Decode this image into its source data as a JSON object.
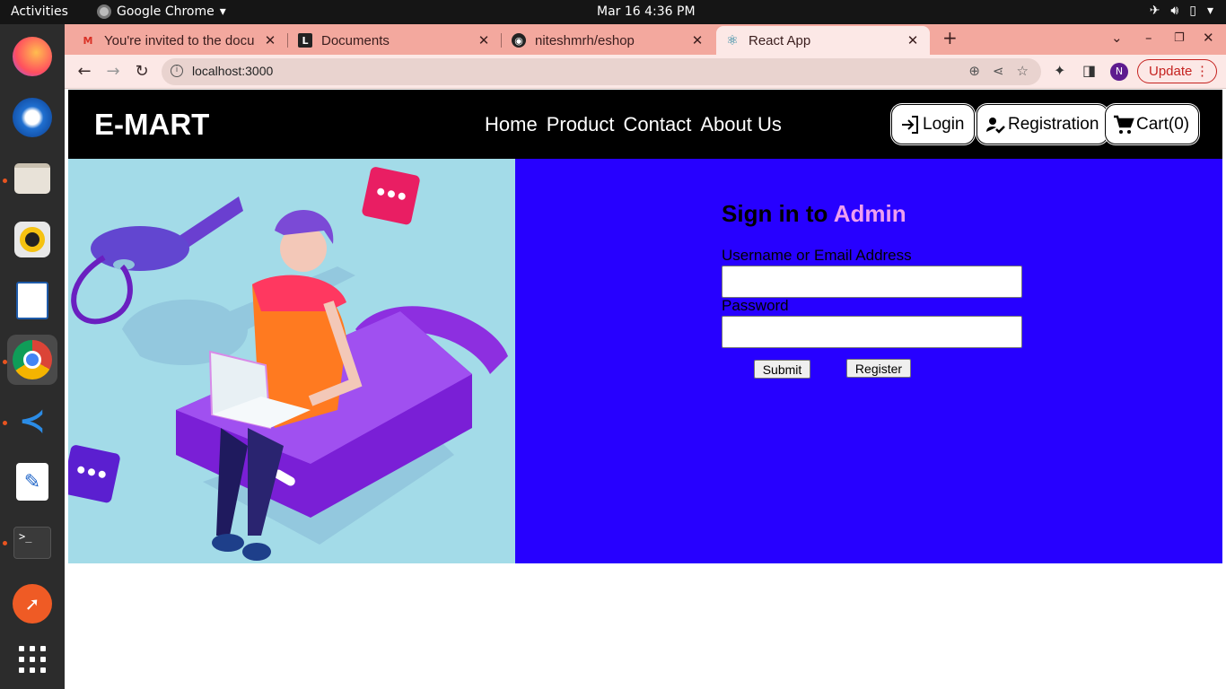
{
  "os": {
    "activities": "Activities",
    "app_menu": "Google Chrome",
    "clock": "Mar 16  4:36 PM",
    "dock_apps": [
      "firefox-icon",
      "thunderbird-icon",
      "files-icon",
      "rhythmbox-icon",
      "libreoffice-writer-icon",
      "chrome-icon",
      "vscode-icon",
      "text-editor-icon",
      "terminal-icon",
      "postman-icon",
      "app-grid-icon"
    ]
  },
  "browser": {
    "tabs": [
      {
        "title": "You're invited to the docu",
        "active": false
      },
      {
        "title": "Documents",
        "active": false
      },
      {
        "title": "niteshmrh/eshop",
        "active": false
      },
      {
        "title": "React App",
        "active": true
      }
    ],
    "url": "localhost:3000",
    "profile_initial": "N",
    "update_label": "Update"
  },
  "site": {
    "brand": "E-MART",
    "nav_links": [
      "Home",
      "Product",
      "Contact",
      "About Us"
    ],
    "login_label": "Login",
    "registration_label": "Registration",
    "cart_label": "Cart(0)"
  },
  "signin": {
    "title_prefix": "Sign in to",
    "title_accent": "Admin",
    "username_label": "Username or Email Address",
    "username_value": "",
    "password_label": "Password",
    "password_value": "",
    "submit_label": "Submit",
    "register_label": "Register"
  },
  "colors": {
    "navbar_bg": "#000000",
    "hero_left_bg": "#a3dbe8",
    "hero_right_bg": "#2700ff",
    "accent": "#ee9ff0",
    "tabstrip": "#f3a89e"
  }
}
